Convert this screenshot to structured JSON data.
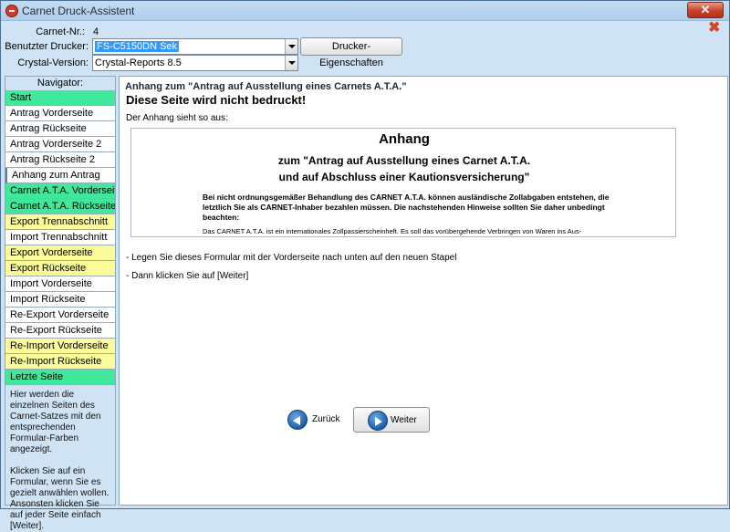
{
  "window": {
    "title": "Carnet Druck-Assistent"
  },
  "header": {
    "carnet_label": "Carnet-Nr.:",
    "carnet_value": "4",
    "printer_label": "Benutzter Drucker:",
    "printer_value": "FS-C5150DN Sek",
    "printer_props_button": "Drucker-Eigenschaften",
    "crystal_label": "Crystal-Version:",
    "crystal_value": "Crystal-Reports 8.5"
  },
  "navigator": {
    "heading": "Navigator:",
    "items": [
      {
        "label": "Start",
        "color": "#3fe89a"
      },
      {
        "label": "Antrag Vorderseite",
        "color": "#ffffff"
      },
      {
        "label": "Antrag Rückseite",
        "color": "#ffffff"
      },
      {
        "label": "Antrag Vorderseite 2",
        "color": "#ffffff"
      },
      {
        "label": "Antrag Rückseite 2",
        "color": "#ffffff"
      },
      {
        "label": "Anhang zum Antrag",
        "color": "#ffffff",
        "active": true
      },
      {
        "label": "Carnet A.T.A. Vorderseite",
        "color": "#3fe89a"
      },
      {
        "label": "Carnet A.T.A. Rückseite",
        "color": "#3fe89a"
      },
      {
        "label": "Export Trennabschnitt",
        "color": "#fbfb9a"
      },
      {
        "label": "Import Trennabschnitt",
        "color": "#ffffff"
      },
      {
        "label": "Export Vorderseite",
        "color": "#fbfb9a"
      },
      {
        "label": "Export Rückseite",
        "color": "#fbfb9a"
      },
      {
        "label": "Import Vorderseite",
        "color": "#ffffff"
      },
      {
        "label": "Import Rückseite",
        "color": "#ffffff"
      },
      {
        "label": "Re-Export Vorderseite",
        "color": "#ffffff"
      },
      {
        "label": "Re-Export Rückseite",
        "color": "#ffffff"
      },
      {
        "label": "Re-Import Vorderseite",
        "color": "#fbfb9a"
      },
      {
        "label": "Re-Import Rückseite",
        "color": "#fbfb9a"
      },
      {
        "label": "Letzte Seite",
        "color": "#3fe89a"
      }
    ],
    "help_1": "Hier werden die einzelnen Seiten des Carnet-Satzes mit den entsprechenden Formular-Farben angezeigt.",
    "help_2": "Klicken Sie auf ein Formular, wenn Sie es gezielt anwählen wollen. Ansonsten klicken Sie auf jeder Seite einfach [Weiter]."
  },
  "main": {
    "sub_heading": "Anhang zum \"Antrag auf Ausstellung eines Carnets A.T.A.\"",
    "heading": "Diese Seite wird nicht bedruckt!",
    "intro": "Der Anhang sieht so aus:",
    "preview": {
      "title": "Anhang",
      "subtitle_1": "zum \"Antrag auf Ausstellung eines Carnet A.T.A.",
      "subtitle_2": "und auf Abschluss einer Kautionsversicherung\"",
      "bold_text": "Bei nicht ordnungsgemäßer Behandlung  des CARNET A.T.A. können ausländische Zollabgaben entstehen, die letztlich Sie als CARNET-Inhaber bezahlen müssen. Die nachstehenden Hinweise sollten Sie daher unbedingt beachten:",
      "small_text": "Das CARNET A.T.A.  ist ein internationales Zollpassierscheinheft. Es soll das vorübergehende Verbringen von Waren ins Aus-"
    },
    "instruction_1": "- Legen Sie dieses Formular mit der Vorderseite nach unten auf den neuen Stapel",
    "instruction_2": "- Dann klicken Sie auf [Weiter]",
    "back_button": "Zurück",
    "next_button": "Weiter"
  }
}
